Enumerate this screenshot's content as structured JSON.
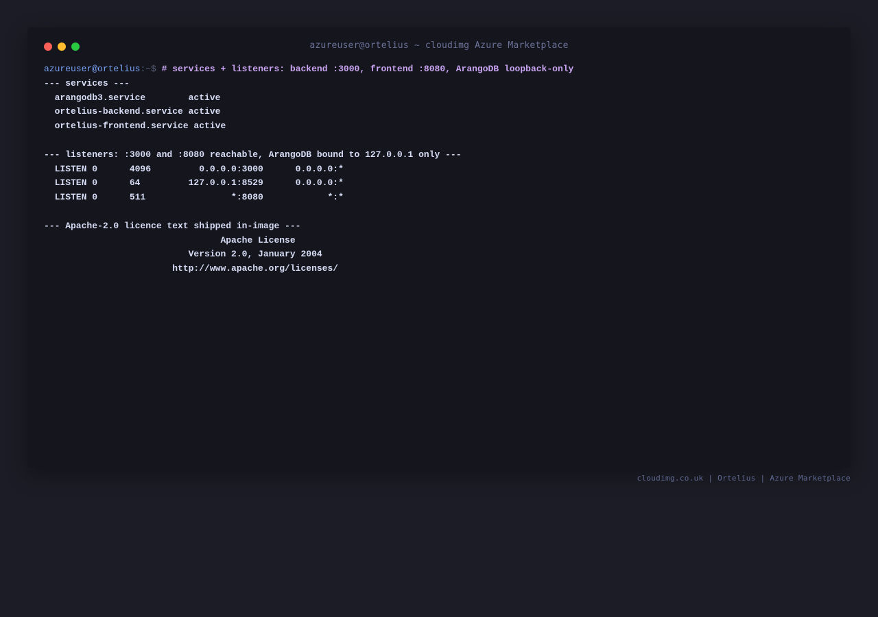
{
  "window": {
    "title": "azureuser@ortelius ~ cloudimg Azure Marketplace",
    "buttons": {
      "close_color": "#ff5f57",
      "minimize_color": "#febc2e",
      "maximize_color": "#28c840"
    }
  },
  "terminal": {
    "prompt_user": "azureuser@ortelius",
    "prompt_path": ":~$ ",
    "command": "# services + listeners: backend :3000, frontend :8080, ArangoDB loopback-only",
    "output": [
      "--- services ---",
      "  arangodb3.service        active",
      "  ortelius-backend.service active",
      "  ortelius-frontend.service active",
      "",
      "--- listeners: :3000 and :8080 reachable, ArangoDB bound to 127.0.0.1 only ---",
      "  LISTEN 0      4096         0.0.0.0:3000      0.0.0.0:*",
      "  LISTEN 0      64         127.0.0.1:8529      0.0.0.0:*",
      "  LISTEN 0      511                *:8080            *:*",
      "",
      "--- Apache-2.0 licence text shipped in-image ---",
      "                                 Apache License",
      "                           Version 2.0, January 2004",
      "                        http://www.apache.org/licenses/"
    ]
  },
  "footer": {
    "text": "cloudimg.co.uk | Ortelius | Azure Marketplace"
  }
}
